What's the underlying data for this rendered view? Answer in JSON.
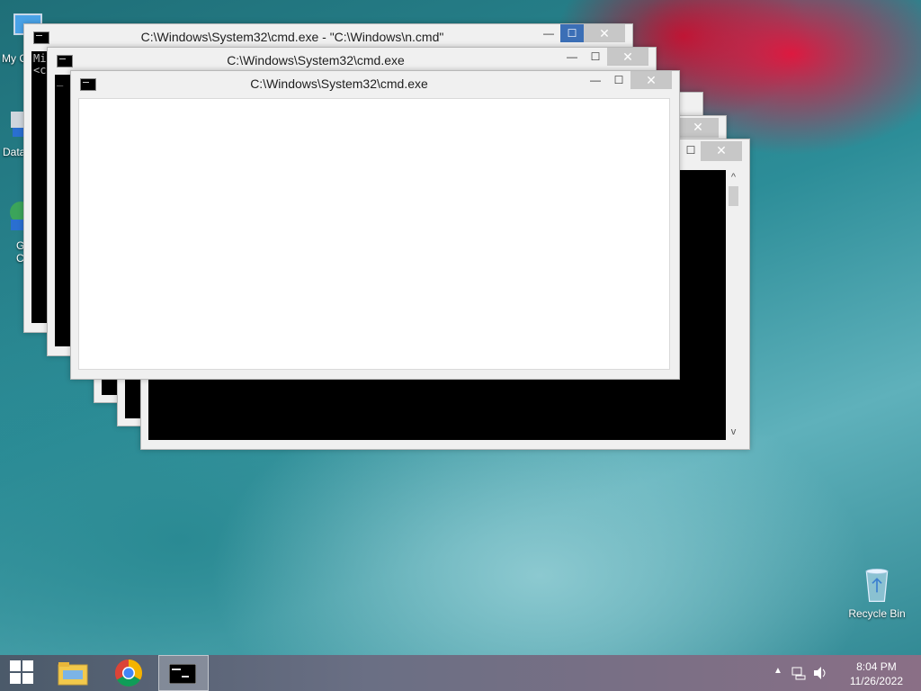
{
  "desktop": {
    "icons": [
      {
        "label": "Recycle Bin",
        "name": "recycle-bin"
      }
    ],
    "partial_labels": [
      "My C",
      "Data",
      "G",
      "C"
    ]
  },
  "windows": [
    {
      "title": "C:\\Windows\\System32\\cmd.exe - \"C:\\Windows\\n.cmd\"",
      "console_lines": [
        "Mi",
        "<c"
      ]
    },
    {
      "title": "C:\\Windows\\System32\\cmd.exe",
      "console_lines": [
        "_"
      ]
    },
    {
      "title": "C:\\Windows\\System32\\cmd.exe"
    }
  ],
  "window_buttons": {
    "minimize": "—",
    "maximize": "☐",
    "close": "✕"
  },
  "scroll": {
    "up": "^",
    "down": "v"
  },
  "taskbar": {
    "items": [
      "Start",
      "File Explorer",
      "Google Chrome",
      "Command Prompt"
    ],
    "clock_time": "8:04 PM",
    "clock_date": "11/26/2022"
  }
}
